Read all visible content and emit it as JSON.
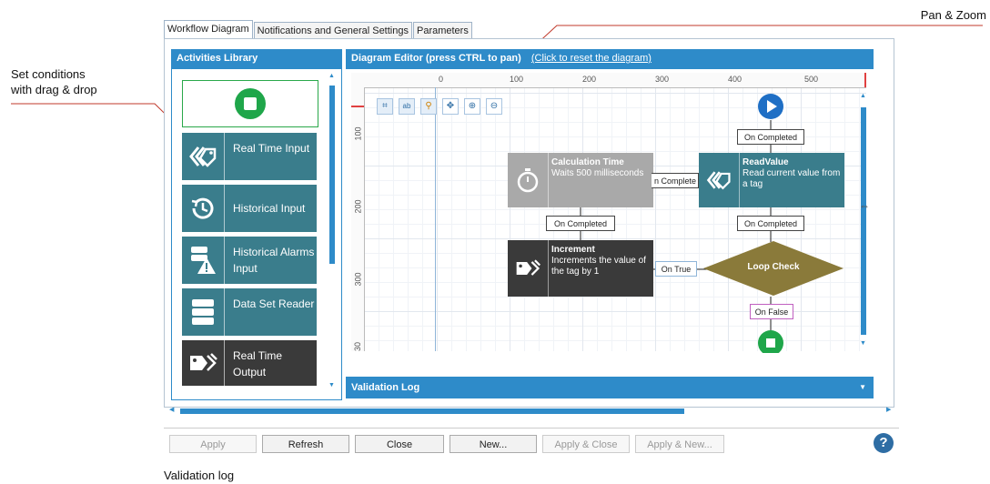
{
  "callouts": {
    "pan_zoom": "Pan & Zoom",
    "conditions_line1": "Set conditions",
    "conditions_line2": "with drag & drop",
    "validation": "Validation log"
  },
  "tabs": [
    {
      "label": "Workflow Diagram",
      "active": true
    },
    {
      "label": "Notifications and General Settings",
      "active": false
    },
    {
      "label": "Parameters",
      "active": false
    }
  ],
  "library": {
    "title": "Activities Library",
    "items": [
      {
        "label": "Real Time Input",
        "icon": "tag-arrows-icon",
        "color": "#3a7d8c"
      },
      {
        "label": "Historical Input",
        "icon": "history-icon",
        "color": "#3a7d8c"
      },
      {
        "label": "Historical Alarms Input",
        "icon": "alarm-warning-icon",
        "color": "#3a7d8c"
      },
      {
        "label": "Data Set Reader",
        "icon": "dataset-icon",
        "color": "#3a7d8c"
      },
      {
        "label": "Real Time Output",
        "icon": "tag-output-icon",
        "color": "#3a3a3a"
      }
    ]
  },
  "editor": {
    "title": "Diagram Editor (press CTRL to pan)",
    "reset_link": "(Click to reset the diagram)",
    "ruler_x": [
      "0",
      "100",
      "200",
      "300",
      "400",
      "500"
    ],
    "ruler_y": [
      "100",
      "200",
      "300",
      "30"
    ],
    "nodes": {
      "calc": {
        "title": "Calculation Time",
        "desc": "Waits 500 milliseconds",
        "color": "#a9a9a9"
      },
      "read": {
        "title": "ReadValue",
        "desc": "Read current value from a tag",
        "color": "#3a7d8c"
      },
      "inc": {
        "title": "Increment",
        "desc": "Increments the value of the tag by 1",
        "color": "#3a3a3a"
      },
      "loop": {
        "title": "Loop Check",
        "color": "#8a7a3a"
      }
    },
    "labels": {
      "completed1": "On Completed",
      "completed2": "n Complete",
      "completed3": "On Completed",
      "completed4": "On Completed",
      "on_true": "On True",
      "on_false": "On False"
    }
  },
  "validation": {
    "title": "Validation Log"
  },
  "buttons": {
    "apply": "Apply",
    "refresh": "Refresh",
    "close": "Close",
    "new": "New...",
    "apply_close": "Apply & Close",
    "apply_new": "Apply & New..."
  },
  "colors": {
    "accent": "#2e8bc9",
    "start": "#1f6fc5",
    "stop": "#1fa64a"
  }
}
